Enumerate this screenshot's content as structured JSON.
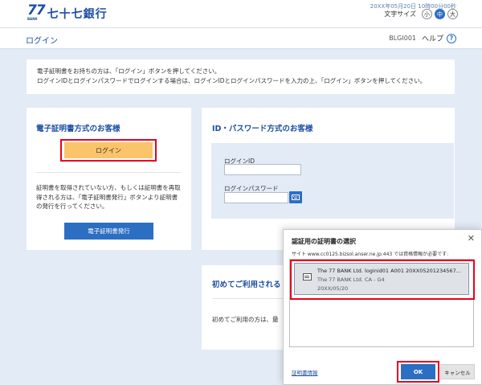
{
  "header": {
    "logo_mark": "77",
    "logo_sub": "BANK",
    "logo_name": "七十七銀行",
    "datetime": "20XX年05月20日 10時00分00秒",
    "fontsize_label": "文字サイズ",
    "fontsize_options": [
      "小",
      "中",
      "大"
    ],
    "fontsize_selected": "中"
  },
  "titlebar": {
    "title": "ログイン",
    "page_id": "BLGI001",
    "help_label": "ヘルプ",
    "help_icon": "?"
  },
  "info": {
    "line1": "電子証明書をお持ちの方は、「ログイン」ボタンを押してください。",
    "line2": "ログインIDとログインパスワードでログインする場合は、ログインIDとログインパスワードを入力の上、「ログイン」ボタンを押してください。"
  },
  "cert_card": {
    "title": "電子証明書方式のお客様",
    "login_label": "ログイン",
    "description": "証明書を取得されていない方、もしくは証明書を再取得される方は、「電子証明書発行」ボタンより証明書の発行を行ってください。",
    "issue_label": "電子証明書発行"
  },
  "id_card": {
    "title": "ID・パスワード方式のお客様",
    "id_label": "ログインID",
    "pw_label": "ログインパスワード"
  },
  "first_card": {
    "title": "初めてご利用される",
    "description": "初めてご利用の方は、最"
  },
  "dialog": {
    "title": "認証用の証明書の選択",
    "close": "✕",
    "site": "サイト www.cc0125.bizsol.anser.ne.jp:443 では資格情報が必要です:",
    "cert_line1": "The 77 BANK Ltd. loginid01 A001 20XX05201234567...",
    "cert_line2": "The 77 BANK Ltd. CA - G4",
    "cert_line3": "20XX/05/20",
    "info_link": "証明書情報",
    "ok_label": "OK",
    "cancel_label": "キャンセル"
  }
}
